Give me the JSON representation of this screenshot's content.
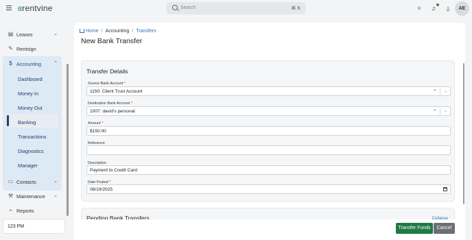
{
  "app": {
    "logo_text": "rentvine",
    "logo_mark": "ɞ"
  },
  "search": {
    "placeholder": "Search",
    "shortcut": "⌘ K"
  },
  "user": {
    "initials": "AE"
  },
  "icons": {
    "magic": "✧",
    "bell": "♫",
    "user": "⍙"
  },
  "sidebar": {
    "leases": "Leases",
    "rentsign": "Rentsign",
    "accounting": "Accounting",
    "accounting_items": [
      "Dashboard",
      "Money In",
      "Money Out",
      "Banking",
      "Transactions",
      "Diagnostics",
      "Manager"
    ],
    "active": "Banking",
    "contacts": "Contacts",
    "maintenance": "Maintenance",
    "reports": "Reports",
    "time": "123 PM"
  },
  "breadcrumb": {
    "home": "Home",
    "accounting": "Accounting",
    "transfers": "Transfers"
  },
  "page": {
    "title": "New Bank Transfer"
  },
  "transfer_details": {
    "title": "Transfer Details",
    "source_label": "Source Bank Account",
    "source_value": "1150: Client Trust Account",
    "destination_label": "Destination Bank Account",
    "destination_value": "1007: david's personal",
    "amount_label": "Amount",
    "amount_value": "$150.00",
    "reference_label": "Reference",
    "reference_value": "",
    "description_label": "Description",
    "description_value": "Payment to Credit Card",
    "date_label": "Date Posted",
    "date_value": "08/19/2025",
    "required_mark": "*"
  },
  "pending": {
    "title": "Pending Bank Transfers",
    "collapse": "Collapse"
  },
  "actions": {
    "submit": "Transfer Funds",
    "cancel": "Cancel"
  },
  "colors": {
    "brand": "#1f7a45",
    "link": "#2f6fb8",
    "active_nav": "#1d3f66"
  }
}
